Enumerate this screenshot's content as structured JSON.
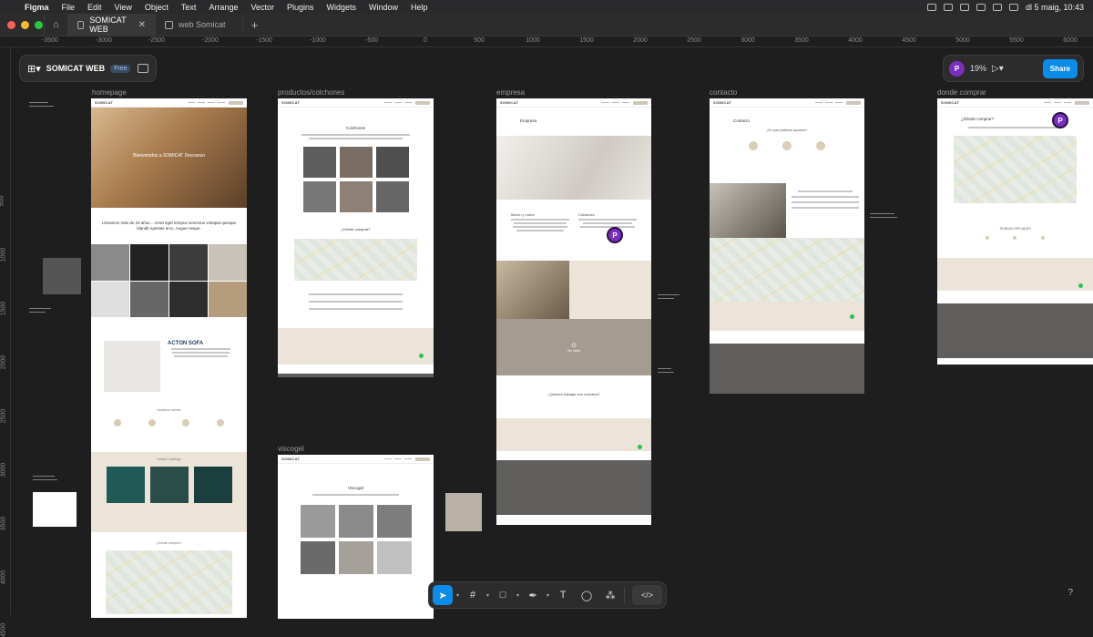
{
  "menubar": {
    "app": "Figma",
    "items": [
      "File",
      "Edit",
      "View",
      "Object",
      "Text",
      "Arrange",
      "Vector",
      "Plugins",
      "Widgets",
      "Window",
      "Help"
    ],
    "clock": "dl 5 maig, 10:43"
  },
  "tabs": [
    {
      "label": "SOMICAT WEB",
      "active": true
    },
    {
      "label": "web Somicat",
      "active": false
    }
  ],
  "rulers": {
    "top": [
      "-3500",
      "-3000",
      "-2500",
      "-2000",
      "-1500",
      "-1000",
      "-500",
      "0",
      "500",
      "1000",
      "1500",
      "2000",
      "2500",
      "3000",
      "3500",
      "4000",
      "4500",
      "5000",
      "5500",
      "6000"
    ],
    "left": [
      "0",
      "500",
      "1000",
      "1500",
      "2000",
      "2500",
      "3000",
      "3500",
      "4000",
      "4500"
    ]
  },
  "file_panel": {
    "name": "SOMICAT WEB",
    "plan": "Free"
  },
  "share_panel": {
    "avatar": "P",
    "zoom": "19%",
    "share_label": "Share"
  },
  "frames": {
    "homepage": {
      "label": "homepage",
      "hero_title": "Bienvenidos a SOMICAT Descanso",
      "tagline": "Llevamos más de 15 años... Amet eget tempus senectus volutpat quisque blandit egestas arcu. Augue neque.",
      "brand": "ACTON SOFA",
      "section": "Nuestros valores",
      "catalog": "Nuestro catálogo",
      "where": "¿Dónde comprar?"
    },
    "productos": {
      "label": "productos/colchones",
      "title": "Colchones",
      "where": "¿Dónde comprar?"
    },
    "viscogel": {
      "label": "viscogel",
      "title": "Viscogel"
    },
    "empresa": {
      "label": "empresa",
      "title": "Empresa",
      "col1": "Misión y visión",
      "col2": "Calidades",
      "video": "Ver vídeo",
      "cta": "¿Quieres trabajar con nosotros?"
    },
    "contacto": {
      "label": "contacto",
      "title": "Contacto",
      "question": "¿En qué podemos ayudarte?"
    },
    "donde": {
      "label": "donde comprar",
      "title": "¿Dónde comprar?",
      "stores": "TIENDAS OFICIALES"
    }
  },
  "footer_brand": "SOMICAT",
  "collaborator": "P",
  "toolbar": {
    "tools": [
      "move",
      "frame",
      "shape",
      "pen",
      "text",
      "comment",
      "actions",
      "dev-mode"
    ]
  },
  "help": "?"
}
